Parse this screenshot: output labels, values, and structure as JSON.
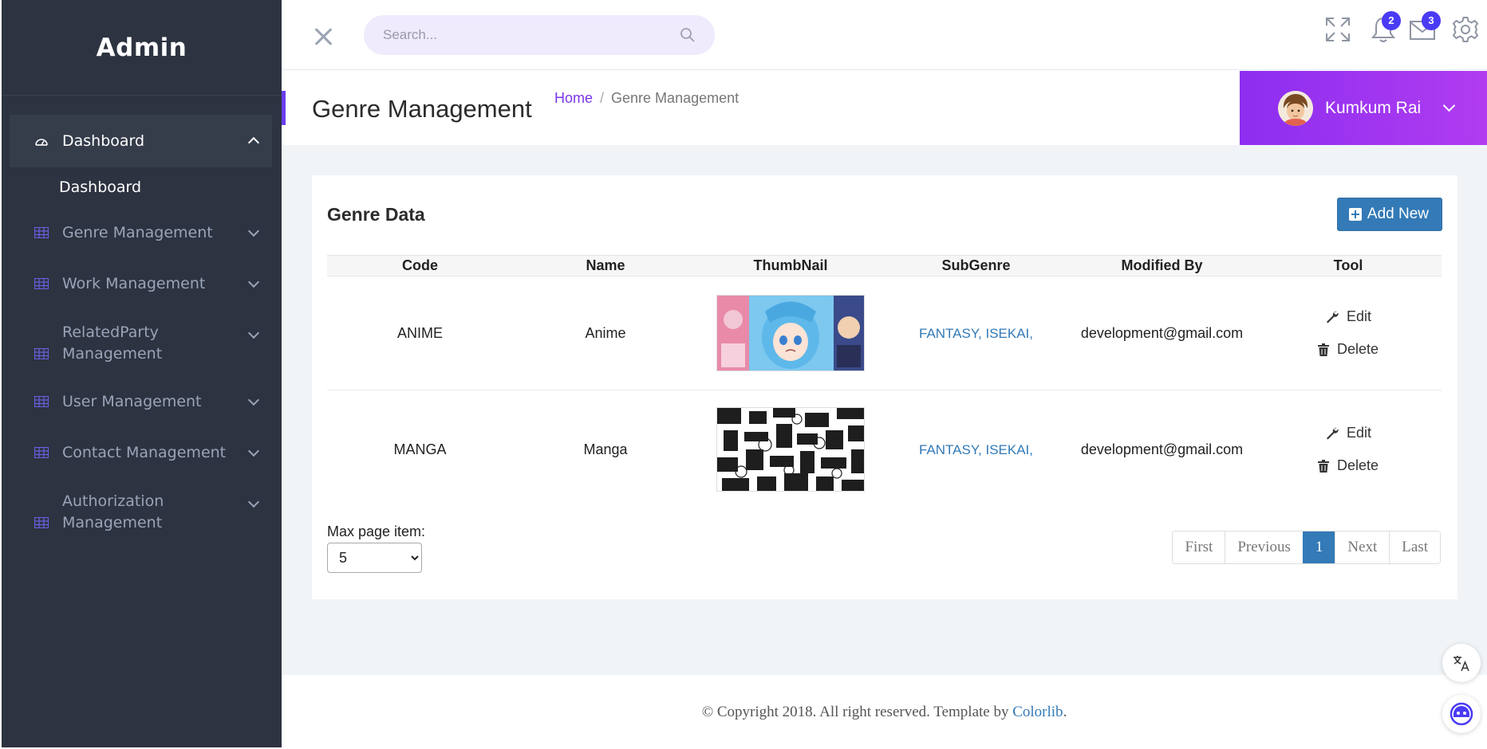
{
  "brand": "Admin",
  "sidebar": {
    "items": [
      {
        "label": "Dashboard",
        "icon": "speedometer-icon",
        "expanded": true,
        "children": [
          "Dashboard"
        ]
      },
      {
        "label": "Genre Management",
        "icon": "table-icon"
      },
      {
        "label": "Work Management",
        "icon": "table-icon"
      },
      {
        "label": "RelatedParty Management",
        "icon": "table-icon"
      },
      {
        "label": "User Management",
        "icon": "table-icon"
      },
      {
        "label": "Contact Management",
        "icon": "table-icon"
      },
      {
        "label": "Authorization Management",
        "icon": "table-icon"
      }
    ]
  },
  "topbar": {
    "search_placeholder": "Search...",
    "notifications_count": "2",
    "messages_count": "3"
  },
  "header": {
    "title": "Genre Management",
    "breadcrumb": [
      "Home",
      "Genre Management"
    ],
    "user_name": "Kumkum Rai"
  },
  "card": {
    "title": "Genre Data",
    "add_label": "Add New"
  },
  "table": {
    "columns": [
      "Code",
      "Name",
      "ThumbNail",
      "SubGenre",
      "Modified By",
      "Tool"
    ],
    "rows": [
      {
        "code": "ANIME",
        "name": "Anime",
        "thumbnail": "anime-art",
        "subgenres": [
          "FANTASY,",
          "ISEKAI,"
        ],
        "modified_by": "development@gmail.com"
      },
      {
        "code": "MANGA",
        "name": "Manga",
        "thumbnail": "manga-collage",
        "subgenres": [
          "FANTASY,",
          "ISEKAI,"
        ],
        "modified_by": "development@gmail.com"
      }
    ],
    "edit_label": "Edit",
    "delete_label": "Delete"
  },
  "pager": {
    "max_label": "Max page item:",
    "max_value": "5",
    "buttons": [
      "First",
      "Previous",
      "1",
      "Next",
      "Last"
    ],
    "current_page": "1"
  },
  "footer": {
    "text": "© Copyright 2018. All right reserved. Template by ",
    "link": "Colorlib",
    "suffix": "."
  },
  "colors": {
    "sidebar_bg": "#2d3340",
    "accent_purple": "#8c2ef0",
    "primary_blue": "#337ab7",
    "badge": "#4a3bf5"
  }
}
